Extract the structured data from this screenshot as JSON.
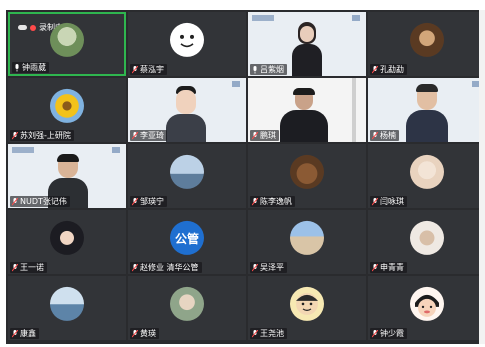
{
  "recording": {
    "label": "录制中"
  },
  "avatar_labels": {
    "gonggu": "公管"
  },
  "participants": [
    {
      "name": "钟雨葳"
    },
    {
      "name": "蔡泓宇"
    },
    {
      "name": "吕紫烟"
    },
    {
      "name": "孔勐勐"
    },
    {
      "name": "苏刘强-上研院"
    },
    {
      "name": "李亚琦"
    },
    {
      "name": "鹏琪"
    },
    {
      "name": "杨楠"
    },
    {
      "name": "NUDT张记伟"
    },
    {
      "name": "邹瑛宁"
    },
    {
      "name": "陈李逸帆"
    },
    {
      "name": "闫咏琪"
    },
    {
      "name": "王一诺"
    },
    {
      "name": "赵修业 清华公管"
    },
    {
      "name": "吴泽平"
    },
    {
      "name": "申青青"
    },
    {
      "name": "康鑫"
    },
    {
      "name": "黄瑛"
    },
    {
      "name": "王尧池"
    },
    {
      "name": "钟少霞"
    }
  ],
  "colors": {
    "active_border": "#2fb64f",
    "tile_bg": "#323438",
    "grid_bg": "#2a2b2e",
    "muted_mic": "#ff4a4a"
  }
}
